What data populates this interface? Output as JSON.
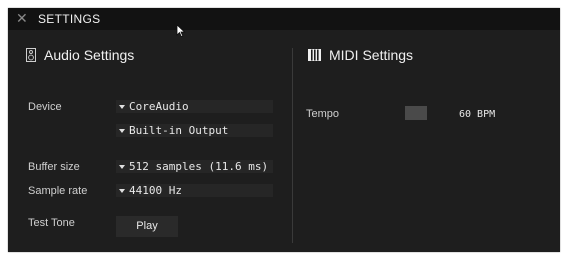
{
  "window": {
    "title": "SETTINGS",
    "close_icon": "close-icon",
    "close_glyph": "✕"
  },
  "audio": {
    "heading": "Audio Settings",
    "icon": "speaker-icon",
    "device_label": "Device",
    "device_value": "CoreAudio",
    "output_value": "Built-in Output",
    "buffer_label": "Buffer size",
    "buffer_value": "512 samples (11.6 ms)",
    "samplerate_label": "Sample rate",
    "samplerate_value": "44100 Hz",
    "testtone_label": "Test Tone",
    "play_label": "Play"
  },
  "midi": {
    "heading": "MIDI Settings",
    "icon": "piano-keys-icon",
    "tempo_label": "Tempo",
    "tempo_value": "60 BPM"
  }
}
